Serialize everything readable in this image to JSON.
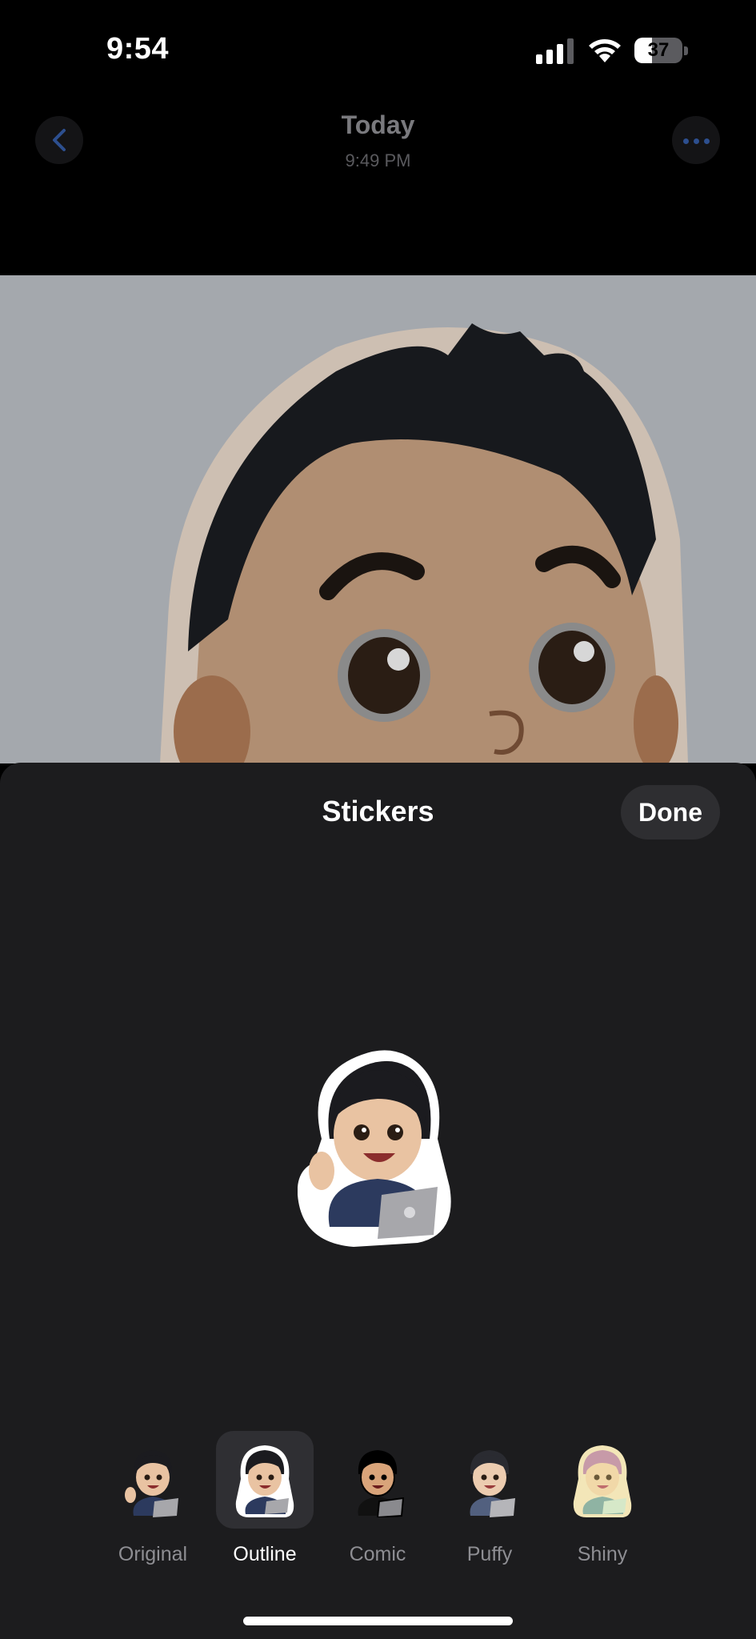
{
  "status_bar": {
    "time": "9:54",
    "battery_level": "37",
    "battery_fraction": 0.37
  },
  "nav": {
    "title": "Today",
    "subtitle": "9:49 PM",
    "back_icon": "chevron-left-icon",
    "more_icon": "ellipsis-icon"
  },
  "sheet": {
    "title": "Stickers",
    "done_label": "Done",
    "styles": [
      {
        "label": "Original",
        "selected": false
      },
      {
        "label": "Outline",
        "selected": true
      },
      {
        "label": "Comic",
        "selected": false
      },
      {
        "label": "Puffy",
        "selected": false
      },
      {
        "label": "Shiny",
        "selected": false
      }
    ]
  },
  "colors": {
    "accent": "#2d4f8f",
    "sheet_bg": "#1c1c1e",
    "selected_thumb_bg": "#2f2f33"
  }
}
